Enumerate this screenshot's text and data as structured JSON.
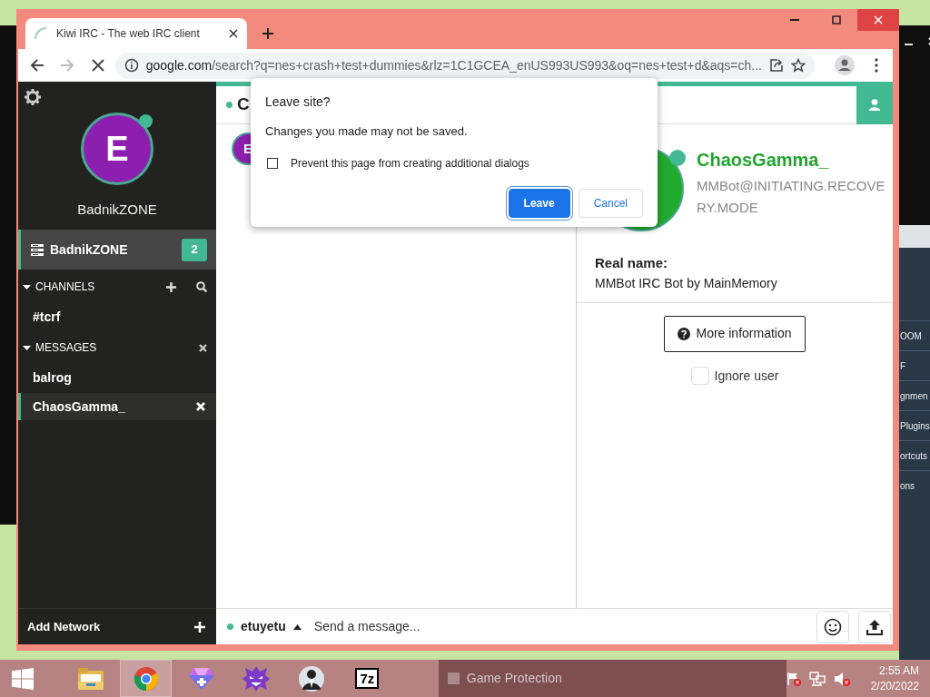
{
  "background_window": {
    "items": [
      "OOM",
      "F",
      "gnmen",
      "Plugins",
      "ortcuts",
      "ons"
    ]
  },
  "browser": {
    "tabs": [
      {
        "title": "Kiwi IRC - The web IRC client",
        "selected": true,
        "loading": true
      }
    ],
    "nav": [
      {
        "kind": "back",
        "disabled": false
      },
      {
        "kind": "forward",
        "disabled": true
      },
      {
        "kind": "stop",
        "disabled": false
      }
    ],
    "url": {
      "host": "google.com",
      "path": "/search?q=nes+crash+test+dummies&rlz=1C1GCEA_enUS993US993&oq=nes+test+d&aqs=ch..."
    }
  },
  "sidebar": {
    "user": {
      "initial": "E",
      "nick": "BadnikZONE",
      "online": true
    },
    "network": {
      "name": "BadnikZONE",
      "badge": "2",
      "selected": true
    },
    "sections": [
      {
        "kind": "channels",
        "title": "CHANNELS",
        "expanded": true,
        "items": [
          {
            "name": "#tcrf",
            "selected": false
          }
        ]
      },
      {
        "kind": "messages",
        "title": "MESSAGES",
        "expanded": true,
        "items": [
          {
            "name": "balrog",
            "selected": false
          },
          {
            "name": "ChaosGamma_",
            "selected": true
          }
        ]
      }
    ],
    "footer": "Add Network"
  },
  "buffer": {
    "title": "C",
    "online": true,
    "message_avatar": "E"
  },
  "user_panel": {
    "nick": "ChaosGamma_",
    "host": "MMBot@INITIATING.RECOVERY.MODE",
    "online": true,
    "realname_label": "Real name:",
    "realname": "MMBot IRC Bot by MainMemory",
    "more_button": "More information",
    "ignore": {
      "label": "Ignore user",
      "checked": false
    }
  },
  "input": {
    "nick": "etuyetu",
    "online": true,
    "placeholder": "Send a message..."
  },
  "dialog": {
    "title": "Leave site?",
    "message": "Changes you made may not be saved.",
    "checkbox": {
      "label": "Prevent this page from creating additional dialogs",
      "checked": false
    },
    "buttons": [
      {
        "label": "Leave",
        "kind": "primary"
      },
      {
        "label": "Cancel",
        "kind": "secondary"
      }
    ]
  },
  "taskbar": {
    "apps": [
      {
        "kind": "explorer",
        "selected": false
      },
      {
        "kind": "chrome",
        "selected": true
      },
      {
        "kind": "gem",
        "selected": false
      },
      {
        "kind": "mascot",
        "selected": false
      },
      {
        "kind": "figure",
        "selected": false
      },
      {
        "kind": "sevenzip",
        "selected": false,
        "label": "7z"
      }
    ],
    "task": "Game Protection",
    "clock": {
      "time": "2:55 AM",
      "date": "2/20/2022"
    }
  }
}
